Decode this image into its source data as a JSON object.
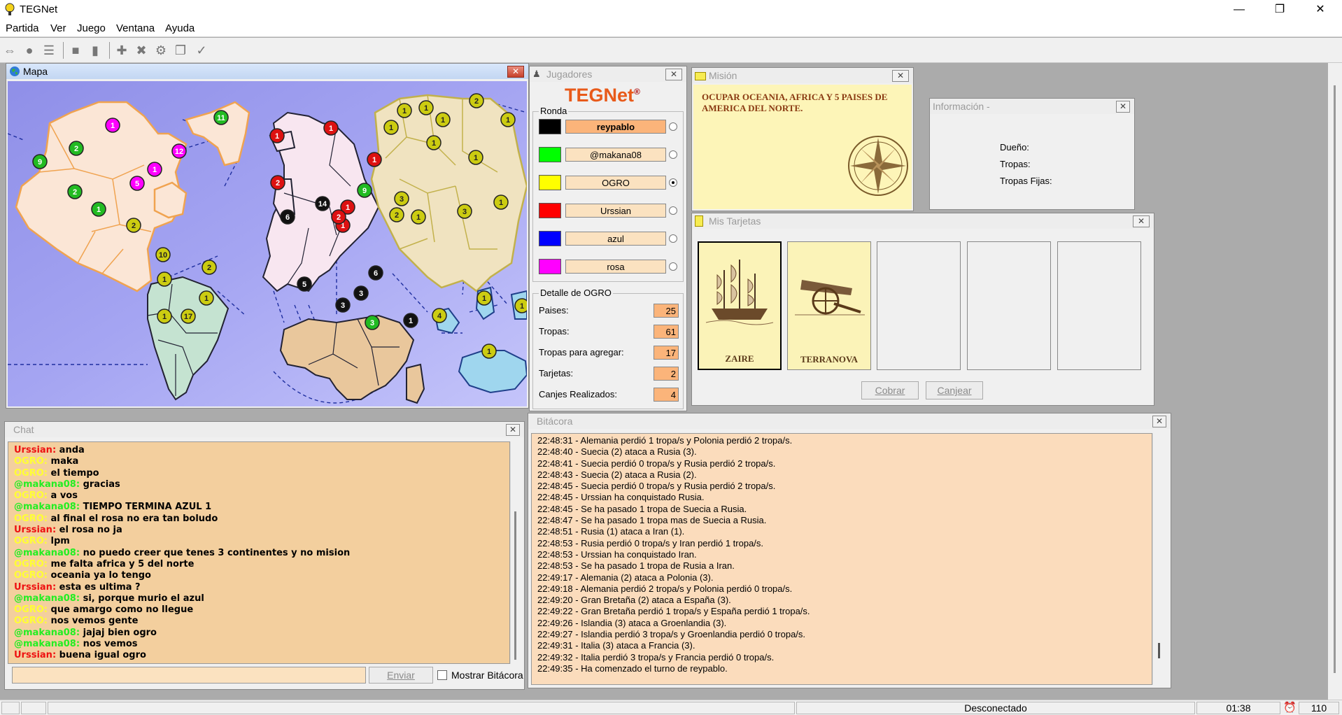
{
  "app": {
    "title": "TEGNet"
  },
  "menu": [
    "Partida",
    "Ver",
    "Juego",
    "Ventana",
    "Ayuda"
  ],
  "windows": {
    "mapa": {
      "title": "Mapa"
    },
    "jugadores": {
      "title": "Jugadores",
      "logo_main": "TEGNet",
      "logo_mark": "®",
      "round_label": "Ronda"
    },
    "mision": {
      "title": "Misión",
      "text": "OCUPAR OCEANIA, AFRICA Y 5 PAISES DE AMERICA DEL NORTE."
    },
    "info": {
      "title": "Información -",
      "owner_label": "Dueño:",
      "troops_label": "Tropas:",
      "fixed_troops_label": "Tropas Fijas:"
    },
    "tarjetas": {
      "title": "Mis Tarjetas",
      "cobrar": "Cobrar",
      "canjear": "Canjear"
    },
    "chat": {
      "title": "Chat",
      "send": "Enviar",
      "show_log": "Mostrar Bitácora"
    },
    "bitacora": {
      "title": "Bitácora"
    }
  },
  "players": [
    {
      "name": "reypablo",
      "color": "#000000",
      "turn": true,
      "selected": false
    },
    {
      "name": "@makana08",
      "color": "#00ff00",
      "turn": false,
      "selected": false
    },
    {
      "name": "OGRO",
      "color": "#ffff00",
      "turn": false,
      "selected": true
    },
    {
      "name": "Urssian",
      "color": "#ff0000",
      "turn": false,
      "selected": false
    },
    {
      "name": "azul",
      "color": "#0000ff",
      "turn": false,
      "selected": false
    },
    {
      "name": "rosa",
      "color": "#ff00ff",
      "turn": false,
      "selected": false
    }
  ],
  "detail": {
    "title": "Detalle de OGRO",
    "rows": [
      {
        "label": "Paises:",
        "value": "25"
      },
      {
        "label": "Tropas:",
        "value": "61"
      },
      {
        "label": "Tropas para agregar:",
        "value": "17"
      },
      {
        "label": "Tarjetas:",
        "value": "2"
      },
      {
        "label": "Canjes Realizados:",
        "value": "4"
      }
    ]
  },
  "cards": [
    {
      "name": "ZAIRE",
      "symbol": "ship-icon"
    },
    {
      "name": "TERRANOVA",
      "symbol": "cannon-icon"
    },
    {
      "name": ""
    },
    {
      "name": ""
    },
    {
      "name": ""
    }
  ],
  "chat": [
    {
      "user": "Urssian",
      "color": "#ee1111",
      "msg": "anda"
    },
    {
      "user": "OGRO",
      "color": "#ffff33",
      "msg": "maka"
    },
    {
      "user": "OGRO",
      "color": "#ffff33",
      "msg": "el tiempo"
    },
    {
      "user": "@makana08",
      "color": "#22ee22",
      "msg": "gracias"
    },
    {
      "user": "OGRO",
      "color": "#ffff33",
      "msg": "a vos"
    },
    {
      "user": "@makana08",
      "color": "#22ee22",
      "msg": "TIEMPO TERMINA AZUL 1"
    },
    {
      "user": "OGRO",
      "color": "#ffff33",
      "msg": "al final el rosa no era tan boludo"
    },
    {
      "user": "Urssian",
      "color": "#ee1111",
      "msg": "el rosa no ja"
    },
    {
      "user": "OGRO",
      "color": "#ffff33",
      "msg": "lpm"
    },
    {
      "user": "@makana08",
      "color": "#22ee22",
      "msg": "no puedo creer que tenes 3 continentes y no mision"
    },
    {
      "user": "OGRO",
      "color": "#ffff33",
      "msg": "me falta africa y 5 del norte"
    },
    {
      "user": "OGRO",
      "color": "#ffff33",
      "msg": "oceania ya lo tengo"
    },
    {
      "user": "Urssian",
      "color": "#ee1111",
      "msg": "esta es ultima ?"
    },
    {
      "user": "@makana08",
      "color": "#22ee22",
      "msg": "si, porque murio el azul"
    },
    {
      "user": "OGRO",
      "color": "#ffff33",
      "msg": "que amargo como no llegue"
    },
    {
      "user": "OGRO",
      "color": "#ffff33",
      "msg": "nos vemos gente"
    },
    {
      "user": "@makana08",
      "color": "#22ee22",
      "msg": "jajaj bien ogro"
    },
    {
      "user": "@makana08",
      "color": "#22ee22",
      "msg": "nos vemos"
    },
    {
      "user": "Urssian",
      "color": "#ee1111",
      "msg": "buena igual ogro"
    }
  ],
  "log": [
    "22:48:31 - Alemania perdió 1 tropa/s y Polonia perdió 2 tropa/s.",
    "22:48:40 - Suecia (2) ataca a Rusia (3).",
    "22:48:41 - Suecia perdió 0 tropa/s y Rusia perdió 2 tropa/s.",
    "22:48:43 - Suecia (2) ataca a Rusia (2).",
    "22:48:45 - Suecia perdió 0 tropa/s y Rusia perdió 2 tropa/s.",
    "22:48:45 - Urssian ha conquistado Rusia.",
    "22:48:45 - Se ha pasado 1 tropa de Suecia a Rusia.",
    "22:48:47 - Se ha pasado 1 tropa mas de Suecia a Rusia.",
    "22:48:51 - Rusia (1) ataca a Iran (1).",
    "22:48:53 - Rusia perdió 0 tropa/s y Iran perdió 1 tropa/s.",
    "22:48:53 - Urssian ha conquistado Iran.",
    "22:48:53 - Se ha pasado 1 tropa de Rusia a Iran.",
    "22:49:17 - Alemania (2) ataca a Polonia (3).",
    "22:49:18 - Alemania perdió 2 tropa/s y Polonia perdió 0 tropa/s.",
    "22:49:20 - Gran Bretaña (2) ataca a España (3).",
    "22:49:22 - Gran Bretaña perdió 1 tropa/s y España perdió 1 tropa/s.",
    "22:49:26 - Islandia (3) ataca a Groenlandia (3).",
    "22:49:27 - Islandia perdió 3 tropa/s y Groenlandia perdió 0 tropa/s.",
    "22:49:31 - Italia (3) ataca a Francia (3).",
    "22:49:32 - Italia perdió 3 tropa/s y Francia perdió 0 tropa/s.",
    "22:49:35 - Ha comenzado el turno de reypablo."
  ],
  "map_tokens": [
    {
      "n": "1",
      "c": "#ff00ff"
    },
    {
      "n": "11",
      "c": "#22bb22"
    },
    {
      "n": "12",
      "c": "#ff00ff"
    },
    {
      "n": "2",
      "c": "#22bb22"
    },
    {
      "n": "9",
      "c": "#22bb22"
    },
    {
      "n": "1",
      "c": "#ff00ff"
    },
    {
      "n": "5",
      "c": "#ff00ff"
    },
    {
      "n": "2",
      "c": "#22bb22"
    },
    {
      "n": "1",
      "c": "#22bb22"
    },
    {
      "n": "2",
      "c": "#cccc11"
    },
    {
      "n": "10",
      "c": "#cccc11"
    },
    {
      "n": "2",
      "c": "#cccc11"
    },
    {
      "n": "1",
      "c": "#cccc11"
    },
    {
      "n": "1",
      "c": "#cccc11"
    },
    {
      "n": "1",
      "c": "#cccc11"
    },
    {
      "n": "17",
      "c": "#cccc11"
    },
    {
      "n": "1",
      "c": "#dd1111"
    },
    {
      "n": "1",
      "c": "#dd1111"
    },
    {
      "n": "2",
      "c": "#dd1111"
    },
    {
      "n": "1",
      "c": "#dd1111"
    },
    {
      "n": "1",
      "c": "#dd1111"
    },
    {
      "n": "1",
      "c": "#dd1111"
    },
    {
      "n": "9",
      "c": "#22bb22"
    },
    {
      "n": "14",
      "c": "#111111"
    },
    {
      "n": "6",
      "c": "#111111"
    },
    {
      "n": "2",
      "c": "#dd1111"
    },
    {
      "n": "1",
      "c": "#cccc11"
    },
    {
      "n": "1",
      "c": "#cccc11"
    },
    {
      "n": "2",
      "c": "#cccc11"
    },
    {
      "n": "1",
      "c": "#cccc11"
    },
    {
      "n": "1",
      "c": "#cccc11"
    },
    {
      "n": "1",
      "c": "#cccc11"
    },
    {
      "n": "1",
      "c": "#cccc11"
    },
    {
      "n": "1",
      "c": "#cccc11"
    },
    {
      "n": "3",
      "c": "#cccc11"
    },
    {
      "n": "2",
      "c": "#cccc11"
    },
    {
      "n": "1",
      "c": "#cccc11"
    },
    {
      "n": "3",
      "c": "#cccc11"
    },
    {
      "n": "1",
      "c": "#cccc11"
    },
    {
      "n": "5",
      "c": "#111111"
    },
    {
      "n": "6",
      "c": "#111111"
    },
    {
      "n": "3",
      "c": "#111111"
    },
    {
      "n": "3",
      "c": "#111111"
    },
    {
      "n": "3",
      "c": "#22bb22"
    },
    {
      "n": "1",
      "c": "#111111"
    },
    {
      "n": "4",
      "c": "#cccc11"
    },
    {
      "n": "1",
      "c": "#cccc11"
    },
    {
      "n": "1",
      "c": "#cccc11"
    },
    {
      "n": "1",
      "c": "#cccc11"
    }
  ],
  "status": {
    "connection": "Desconectado",
    "time": "01:38",
    "ping": "110"
  }
}
